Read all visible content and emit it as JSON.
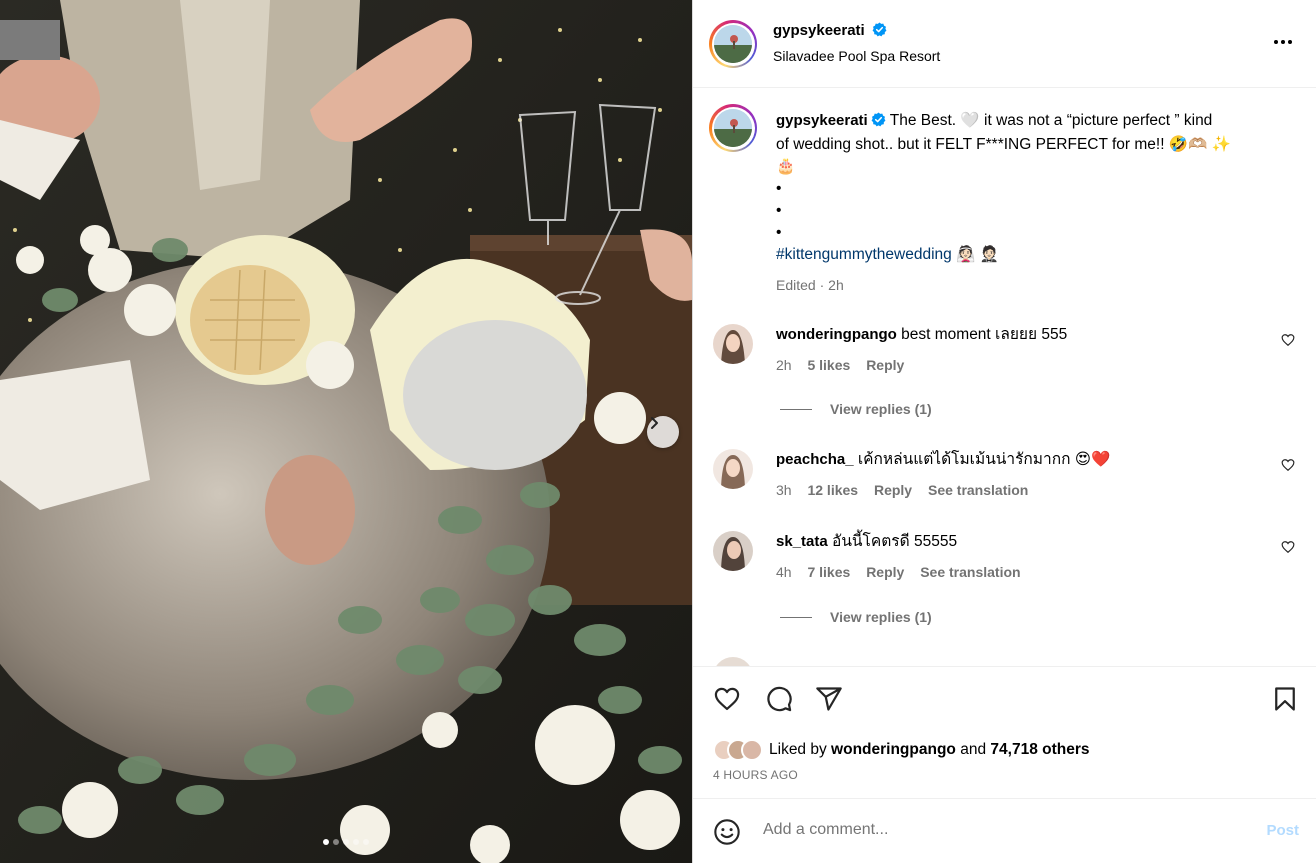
{
  "post": {
    "author": "gypsykeerati",
    "location": "Silavadee Pool Spa Resort",
    "caption": {
      "author": "gypsykeerati",
      "text_line1": "The Best. 🤍  it was not a “picture perfect ” kind",
      "text_line2": "of wedding shot.. but it FELT F***ING PERFECT for me!! 🤣🫶🏼 ✨",
      "text_line3": "🎂",
      "bullets": [
        "•",
        "•",
        "•"
      ],
      "hashtag": "#kittengummythewedding",
      "hashtag_emoji": "👰🏻 🤵🏻",
      "edited": "Edited",
      "time": "2h"
    },
    "media": {
      "current_slide": 1,
      "total_slides": 5
    }
  },
  "comments": [
    {
      "username": "wonderingpango",
      "text": "best moment เลยยย 555",
      "time": "2h",
      "likes": "5 likes",
      "reply": "Reply",
      "view_replies": "View replies (1)"
    },
    {
      "username": "peachcha_",
      "text": "เค้กหล่นแต่ได้โมเม้นน่ารักมากก 😍❤️",
      "time": "3h",
      "likes": "12 likes",
      "reply": "Reply",
      "translation": "See translation"
    },
    {
      "username": "sk_tata",
      "text": "อันนี้โคตรดี 55555",
      "time": "4h",
      "likes": "7 likes",
      "reply": "Reply",
      "translation": "See translation",
      "view_replies": "View replies (1)"
    }
  ],
  "likes_summary": {
    "prefix": "Liked by",
    "user": "wonderingpango",
    "middle": "and",
    "others": "74,718 others"
  },
  "timestamp": "4 HOURS AGO",
  "add_comment": {
    "placeholder": "Add a comment...",
    "post_label": "Post"
  },
  "icons": {
    "verified": "verified-badge-icon",
    "more": "more-options-icon",
    "like": "heart-icon",
    "comment": "comment-icon",
    "share": "share-icon",
    "save": "bookmark-icon",
    "emoji": "emoji-icon",
    "next": "chevron-right-icon"
  },
  "colors": {
    "accent_blue": "#0095f6",
    "hashtag": "#00376b",
    "secondary_text": "#737373",
    "post_disabled": "#b3dbff"
  }
}
